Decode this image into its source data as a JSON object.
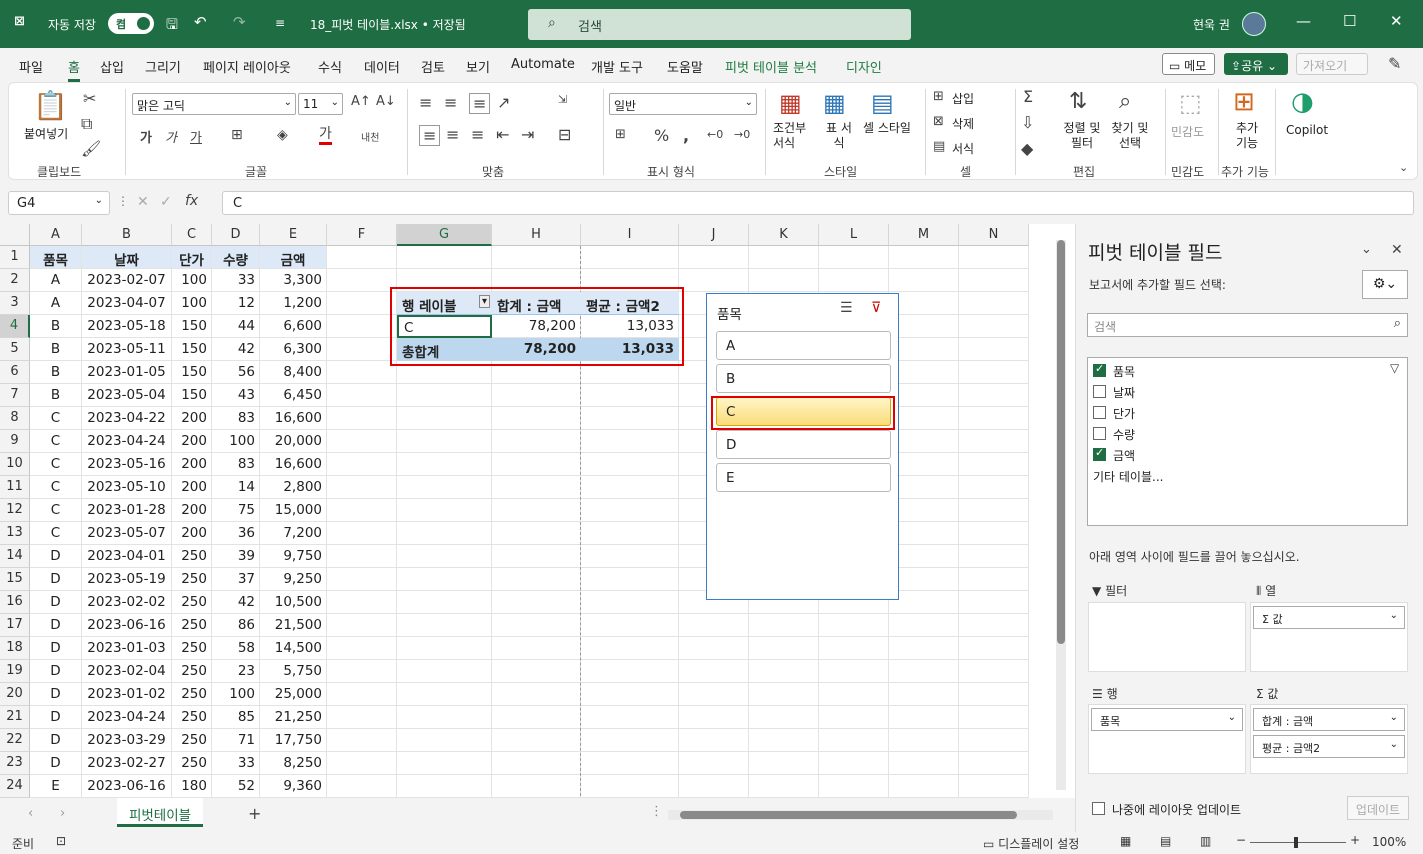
{
  "titlebar": {
    "autosave_label": "자동 저장",
    "autosave_state": "켬",
    "filename": "18_피벗 테이블.xlsx • 저장됨",
    "search_placeholder": "검색",
    "user_name": "현욱 권"
  },
  "menu": {
    "items": [
      "파일",
      "홈",
      "삽입",
      "그리기",
      "페이지 레이아웃",
      "수식",
      "데이터",
      "검토",
      "보기",
      "Automate",
      "개발 도구",
      "도움말",
      "피벗 테이블 분석",
      "디자인"
    ],
    "active": "홈",
    "memo": "메모",
    "share": "공유",
    "fetch": "가져오기"
  },
  "ribbon": {
    "clipboard": {
      "paste": "붙여넣기",
      "label": "클립보드"
    },
    "font": {
      "name": "맑은 고딕",
      "size": "11",
      "label": "글꼴"
    },
    "align": {
      "label": "맞춤"
    },
    "number": {
      "format": "일반",
      "label": "표시 형식"
    },
    "style": {
      "cond": "조건부 서식",
      "table": "표 서식",
      "cell": "셀 스타일",
      "label": "스타일"
    },
    "cells": {
      "insert": "삽입",
      "delete": "삭제",
      "format": "서식",
      "label": "셀"
    },
    "edit": {
      "sort": "정렬 및 필터",
      "find": "찾기 및 선택",
      "label": "편집"
    },
    "sens": {
      "btn": "민감도",
      "label": "민감도"
    },
    "addin": {
      "btn": "추가 기능",
      "label": "추가 기능"
    },
    "copilot": "Copilot"
  },
  "formula": {
    "namebox": "G4",
    "value": "C"
  },
  "columns": [
    "A",
    "B",
    "C",
    "D",
    "E",
    "F",
    "G",
    "H",
    "I",
    "J",
    "K",
    "L",
    "M",
    "N"
  ],
  "table": {
    "headers": [
      "품목",
      "날짜",
      "단가",
      "수량",
      "금액"
    ],
    "rows": [
      [
        "A",
        "2023-02-07",
        "100",
        "33",
        "3,300"
      ],
      [
        "A",
        "2023-04-07",
        "100",
        "12",
        "1,200"
      ],
      [
        "B",
        "2023-05-18",
        "150",
        "44",
        "6,600"
      ],
      [
        "B",
        "2023-05-11",
        "150",
        "42",
        "6,300"
      ],
      [
        "B",
        "2023-01-05",
        "150",
        "56",
        "8,400"
      ],
      [
        "B",
        "2023-05-04",
        "150",
        "43",
        "6,450"
      ],
      [
        "C",
        "2023-04-22",
        "200",
        "83",
        "16,600"
      ],
      [
        "C",
        "2023-04-24",
        "200",
        "100",
        "20,000"
      ],
      [
        "C",
        "2023-05-16",
        "200",
        "83",
        "16,600"
      ],
      [
        "C",
        "2023-05-10",
        "200",
        "14",
        "2,800"
      ],
      [
        "C",
        "2023-01-28",
        "200",
        "75",
        "15,000"
      ],
      [
        "C",
        "2023-05-07",
        "200",
        "36",
        "7,200"
      ],
      [
        "D",
        "2023-04-01",
        "250",
        "39",
        "9,750"
      ],
      [
        "D",
        "2023-05-19",
        "250",
        "37",
        "9,250"
      ],
      [
        "D",
        "2023-02-02",
        "250",
        "42",
        "10,500"
      ],
      [
        "D",
        "2023-06-16",
        "250",
        "86",
        "21,500"
      ],
      [
        "D",
        "2023-01-03",
        "250",
        "58",
        "14,500"
      ],
      [
        "D",
        "2023-02-04",
        "250",
        "23",
        "5,750"
      ],
      [
        "D",
        "2023-01-02",
        "250",
        "100",
        "25,000"
      ],
      [
        "D",
        "2023-04-24",
        "250",
        "85",
        "21,250"
      ],
      [
        "D",
        "2023-03-29",
        "250",
        "71",
        "17,750"
      ],
      [
        "D",
        "2023-02-27",
        "250",
        "33",
        "8,250"
      ],
      [
        "E",
        "2023-06-16",
        "180",
        "52",
        "9,360"
      ]
    ]
  },
  "pivot": {
    "h1": "행 레이블",
    "h2": "합계 : 금액",
    "h3": "평균 : 금액2",
    "row_label": "C",
    "row_sum": "78,200",
    "row_avg": "13,033",
    "total_label": "총합계",
    "total_sum": "78,200",
    "total_avg": "13,033"
  },
  "slicer": {
    "title": "품목",
    "items": [
      "A",
      "B",
      "C",
      "D",
      "E"
    ],
    "selected": "C"
  },
  "sheet": {
    "tab": "피벗테이블"
  },
  "status": {
    "ready": "준비",
    "display": "디스플레이 설정",
    "zoom": "100%"
  },
  "panel": {
    "title": "피벗 테이블 필드",
    "subtitle": "보고서에 추가할 필드 선택:",
    "search": "검색",
    "fields": [
      {
        "name": "품목",
        "checked": true
      },
      {
        "name": "날짜",
        "checked": false
      },
      {
        "name": "단가",
        "checked": false
      },
      {
        "name": "수량",
        "checked": false
      },
      {
        "name": "금액",
        "checked": true
      }
    ],
    "more": "기타 테이블...",
    "drag_hint": "아래 영역 사이에 필드를 끌어 놓으십시오.",
    "filter": "필터",
    "columns": "열",
    "rows": "행",
    "values": "값",
    "col_item": "Σ 값",
    "row_item": "품목",
    "val1": "합계 : 금액",
    "val2": "평균 : 금액2",
    "defer": "나중에 레이아웃 업데이트",
    "update": "업데이트"
  }
}
